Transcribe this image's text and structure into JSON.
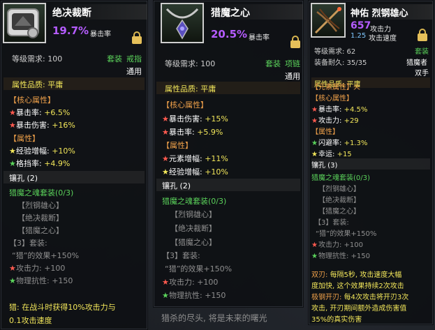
{
  "cards": [
    {
      "title": "绝决裁断",
      "crit_value": "19.7%",
      "crit_label": "暴击率",
      "level_label": "等级需求: 100",
      "set_label": "套装",
      "slot_label": "戒指",
      "usage_label": "通用",
      "quality_label": "属性品质: 平庸",
      "core_header": "【核心属性】",
      "core_1": "暴击率: ",
      "core_1_val": "+6.5%",
      "core_2": "暴击伤害: ",
      "core_2_val": "+16%",
      "attr_header": "【属性】",
      "attr_1": "经验增幅: ",
      "attr_1_val": "+10%",
      "attr_2": "格挡率: ",
      "attr_2_val": "+4.9%",
      "socket": "镶孔 (2)",
      "set_name": "猎魔之魂套装(0/3)",
      "set_item_1": "【烈钢雄心】",
      "set_item_2": "【绝决裁断】",
      "set_item_3": "【猎魔之心】",
      "set_bonus_hdr": "【3】套装:",
      "set_bonus_1": "“猎”的效果+150%",
      "set_bonus_2": "攻击力: +100",
      "set_bonus_3": "物理抗性: +150",
      "desc_1": "猎: 在战斗时获得10%攻击力与",
      "desc_2": "0.1攻击速度"
    },
    {
      "title": "猎魔之心",
      "crit_value": "20.5%",
      "crit_label": "暴击率",
      "level_label": "等级需求: 100",
      "set_label": "套装",
      "slot_label": "项链",
      "usage_label": "通用",
      "quality_label": "属性品质: 平庸",
      "core_header": "【核心属性】",
      "core_1": "暴击伤害: ",
      "core_1_val": "+15%",
      "core_2": "暴击率: ",
      "core_2_val": "+5.9%",
      "attr_header": "【属性】",
      "attr_1": "元素增幅: ",
      "attr_1_val": "+11%",
      "attr_2": "经验增幅: ",
      "attr_2_val": "+10%",
      "socket": "镶孔 (2)",
      "set_name": "猎魔之魂套装(0/3)",
      "set_item_1": "【烈钢雄心】",
      "set_item_2": "【绝决裁断】",
      "set_item_3": "【猎魔之心】",
      "set_bonus_hdr": "【3】套装:",
      "set_bonus_1": "“猎”的效果+150%",
      "set_bonus_2": "攻击力: +100",
      "set_bonus_3": "物理抗性: +150",
      "flavor": "猎杀的尽头, 将是未来的曙光"
    },
    {
      "title": "神佑 烈钢雄心",
      "atk_value": "657",
      "atk_label": "攻击力",
      "speed_value": "1.25",
      "speed_label": "攻击速度",
      "level_label": "等级需求: 62",
      "set_label": "套装",
      "durability_label": "装备耐久: 35/35",
      "class_label": "猎魔者",
      "hand_label": "双手",
      "quality_label": "属性品质: 平庸",
      "element_header": "【元素属性】火",
      "core_header": "【核心属性】",
      "core_1": "暴击率: ",
      "core_1_val": "+4.5%",
      "core_2": "攻击力: ",
      "core_2_val": "+29",
      "attr_header": "【属性】",
      "attr_1": "闪避率: ",
      "attr_1_val": "+1.3%",
      "attr_2": "幸运: ",
      "attr_2_val": "+15",
      "socket": "镶孔 (3)",
      "set_name": "猎魔之魂套装(0/3)",
      "set_item_1": "【烈钢雄心】",
      "set_item_2": "【绝决裁断】",
      "set_item_3": "【猎魔之心】",
      "set_bonus_hdr": "【3】套装:",
      "set_bonus_1": "“猎”的效果+150%",
      "set_bonus_2": "攻击力: +100",
      "set_bonus_3": "物理抗性: +150",
      "skill_1_name": "双刃: ",
      "skill_1_a": "每隔5秒, 攻击速度大幅",
      "skill_1_b": "度加快, 这个效果持续2次攻击",
      "skill_2_name": "极钢开刃: ",
      "skill_2_a": "每4次攻击将开刃3次",
      "skill_2_b": "攻击, 开刃期间额外造成伤害值",
      "skill_2_c": "35%的真实伤害"
    }
  ],
  "colors": {
    "crit_purple": "#b55cff",
    "set_green": "#5bd35b",
    "core_orange": "#f0a14a",
    "value_yellow": "#f2e65a",
    "star_red": "#ff5a4f"
  },
  "icons": [
    "ring-item-icon",
    "necklace-item-icon",
    "crossbow-item-icon",
    "lock-icon",
    "star-icon"
  ]
}
